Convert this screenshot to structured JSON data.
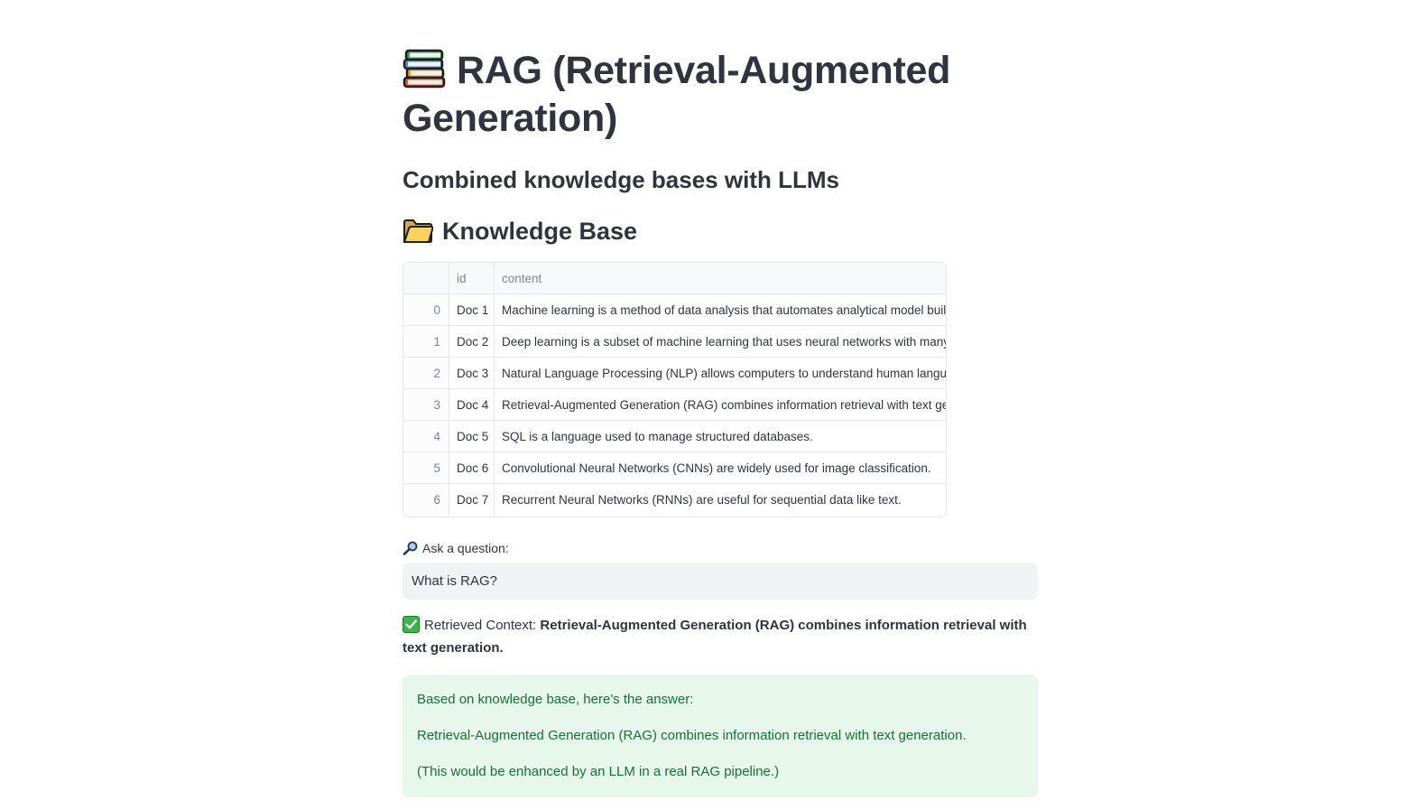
{
  "header": {
    "title": "RAG (Retrieval-Augmented Generation)",
    "subtitle": "Combined knowledge bases with LLMs"
  },
  "knowledge_base": {
    "heading": "Knowledge Base",
    "columns": [
      "",
      "id",
      "content"
    ],
    "rows": [
      {
        "index": "0",
        "id": "Doc 1",
        "content": "Machine learning is a method of data analysis that automates analytical model building."
      },
      {
        "index": "1",
        "id": "Doc 2",
        "content": "Deep learning is a subset of machine learning that uses neural networks with many layers."
      },
      {
        "index": "2",
        "id": "Doc 3",
        "content": "Natural Language Processing (NLP) allows computers to understand human language."
      },
      {
        "index": "3",
        "id": "Doc 4",
        "content": "Retrieval-Augmented Generation (RAG) combines information retrieval with text generation."
      },
      {
        "index": "4",
        "id": "Doc 5",
        "content": "SQL is a language used to manage structured databases."
      },
      {
        "index": "5",
        "id": "Doc 6",
        "content": "Convolutional Neural Networks (CNNs) are widely used for image classification."
      },
      {
        "index": "6",
        "id": "Doc 7",
        "content": "Recurrent Neural Networks (RNNs) are useful for sequential data like text."
      }
    ]
  },
  "question": {
    "label": "Ask a question:",
    "value": "What is RAG?"
  },
  "context": {
    "label": "Retrieved Context:",
    "text": "Retrieval-Augmented Generation (RAG) combines information retrieval with text generation."
  },
  "answer": {
    "intro": "Based on knowledge base, here's the answer:",
    "body": "Retrieval-Augmented Generation (RAG) combines information retrieval with text generation.",
    "note": "(This would be enhanced by an LLM in a real RAG pipeline.)"
  },
  "icons": {
    "title": "books-icon",
    "kb": "folder-icon",
    "ask": "magnifier-icon",
    "context": "check-icon"
  },
  "colors": {
    "text": "#31333f",
    "success_bg": "#e8f7ec",
    "success_text": "#177233",
    "input_bg": "#f0f2f6"
  }
}
